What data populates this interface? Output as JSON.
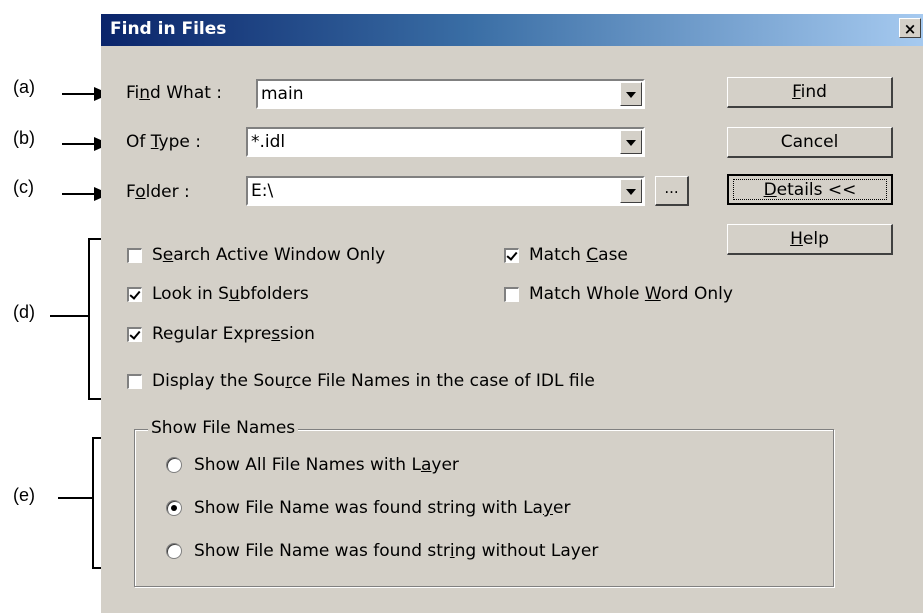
{
  "annotations": [
    "(a)",
    "(b)",
    "(c)",
    "(d)",
    "(e)"
  ],
  "dialog": {
    "title": "Find in Files",
    "close_glyph": "×"
  },
  "fields": {
    "find_what": {
      "label_pre": "Fi",
      "label_u": "n",
      "label_post": "d What :",
      "value": "main"
    },
    "of_type": {
      "label_pre": "Of ",
      "label_u": "T",
      "label_post": "ype :",
      "value": "*.idl"
    },
    "folder": {
      "label_pre": "F",
      "label_u": "o",
      "label_post": "lder :",
      "value": "E:\\",
      "browse_label": "..."
    }
  },
  "buttons": {
    "find": {
      "u": "F",
      "rest": "ind"
    },
    "cancel": "Cancel",
    "details": {
      "u": "D",
      "rest": "etails <<"
    },
    "help": {
      "u": "H",
      "rest": "elp"
    }
  },
  "options": {
    "search_active": {
      "pre": "S",
      "u": "e",
      "post": "arch Active Window Only",
      "checked": false
    },
    "match_case": {
      "pre": "Match ",
      "u": "C",
      "post": "ase",
      "checked": true
    },
    "subfolders": {
      "pre": "Look in S",
      "u": "u",
      "post": "bfolders",
      "checked": true
    },
    "whole_word": {
      "pre": "Match Whole ",
      "u": "W",
      "post": "ord Only",
      "checked": false
    },
    "regex": {
      "pre": "Regular Expre",
      "u": "s",
      "post": "sion",
      "checked": true
    },
    "display_source": {
      "pre": "Display the Sou",
      "u": "r",
      "post": "ce File Names in the case of IDL file",
      "checked": false
    }
  },
  "show_file_names": {
    "group_label": "Show File Names",
    "options": [
      {
        "pre": "Show All File Names with L",
        "u": "a",
        "post": "yer",
        "selected": false
      },
      {
        "pre": "Show File Name was found string with La",
        "u": "y",
        "post": "er",
        "selected": true
      },
      {
        "pre": "Show File Name was found str",
        "u": "i",
        "post": "ng without Layer",
        "selected": false
      }
    ]
  }
}
